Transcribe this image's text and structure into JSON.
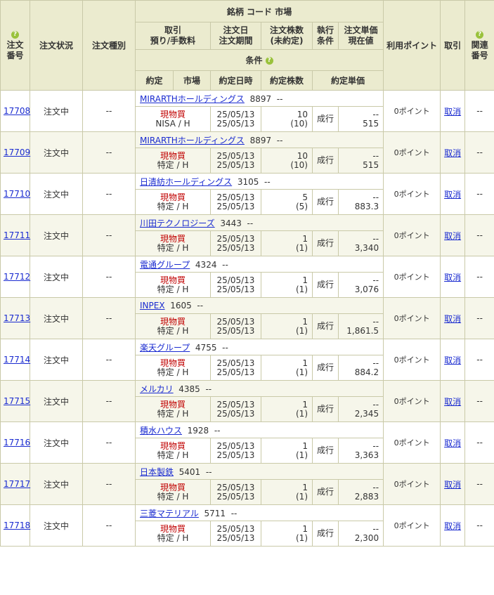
{
  "headers": {
    "order_no": [
      "注文",
      "番号"
    ],
    "status": "注文状況",
    "type": "注文種別",
    "stock": "銘柄 コード 市場",
    "trade": [
      "取引",
      "預り/手数料"
    ],
    "date": [
      "注文日",
      "注文期間"
    ],
    "qty": [
      "注文株数",
      "(未約定)"
    ],
    "exec": [
      "執行",
      "条件"
    ],
    "price": [
      "注文単価",
      "現在値"
    ],
    "cond": "条件",
    "yakujo": "約定",
    "market": "市場",
    "yakujo_date": "約定日時",
    "yakujo_qty": "約定株数",
    "yakujo_price": "約定単価",
    "points": "利用ポイント",
    "action": "取引",
    "related": [
      "関連",
      "番号"
    ]
  },
  "orders": [
    {
      "no": "17708",
      "status": "注文中",
      "type": "--",
      "name": "MIRARTHホールディングス",
      "code": "8897",
      "market": "--",
      "trade": "現物買",
      "account": "NISA / H",
      "d1": "25/05/13",
      "d2": "25/05/13",
      "qty": "10",
      "pending": "(10)",
      "exec": "成行",
      "price": "--",
      "current": "515",
      "points": "0ポイント",
      "action": "取消",
      "related": "--"
    },
    {
      "no": "17709",
      "status": "注文中",
      "type": "--",
      "name": "MIRARTHホールディングス",
      "code": "8897",
      "market": "--",
      "trade": "現物買",
      "account": "特定 / H",
      "d1": "25/05/13",
      "d2": "25/05/13",
      "qty": "10",
      "pending": "(10)",
      "exec": "成行",
      "price": "--",
      "current": "515",
      "points": "0ポイント",
      "action": "取消",
      "related": "--"
    },
    {
      "no": "17710",
      "status": "注文中",
      "type": "--",
      "name": "日清紡ホールディングス",
      "code": "3105",
      "market": "--",
      "trade": "現物買",
      "account": "特定 / H",
      "d1": "25/05/13",
      "d2": "25/05/13",
      "qty": "5",
      "pending": "(5)",
      "exec": "成行",
      "price": "--",
      "current": "883.3",
      "points": "0ポイント",
      "action": "取消",
      "related": "--"
    },
    {
      "no": "17711",
      "status": "注文中",
      "type": "--",
      "name": "川田テクノロジーズ",
      "code": "3443",
      "market": "--",
      "trade": "現物買",
      "account": "特定 / H",
      "d1": "25/05/13",
      "d2": "25/05/13",
      "qty": "1",
      "pending": "(1)",
      "exec": "成行",
      "price": "--",
      "current": "3,340",
      "points": "0ポイント",
      "action": "取消",
      "related": "--"
    },
    {
      "no": "17712",
      "status": "注文中",
      "type": "--",
      "name": "電通グループ",
      "code": "4324",
      "market": "--",
      "trade": "現物買",
      "account": "特定 / H",
      "d1": "25/05/13",
      "d2": "25/05/13",
      "qty": "1",
      "pending": "(1)",
      "exec": "成行",
      "price": "--",
      "current": "3,076",
      "points": "0ポイント",
      "action": "取消",
      "related": "--"
    },
    {
      "no": "17713",
      "status": "注文中",
      "type": "--",
      "name": "INPEX",
      "code": "1605",
      "market": "--",
      "trade": "現物買",
      "account": "特定 / H",
      "d1": "25/05/13",
      "d2": "25/05/13",
      "qty": "1",
      "pending": "(1)",
      "exec": "成行",
      "price": "--",
      "current": "1,861.5",
      "points": "0ポイント",
      "action": "取消",
      "related": "--"
    },
    {
      "no": "17714",
      "status": "注文中",
      "type": "--",
      "name": "楽天グループ",
      "code": "4755",
      "market": "--",
      "trade": "現物買",
      "account": "特定 / H",
      "d1": "25/05/13",
      "d2": "25/05/13",
      "qty": "1",
      "pending": "(1)",
      "exec": "成行",
      "price": "--",
      "current": "884.2",
      "points": "0ポイント",
      "action": "取消",
      "related": "--"
    },
    {
      "no": "17715",
      "status": "注文中",
      "type": "--",
      "name": "メルカリ",
      "code": "4385",
      "market": "--",
      "trade": "現物買",
      "account": "特定 / H",
      "d1": "25/05/13",
      "d2": "25/05/13",
      "qty": "1",
      "pending": "(1)",
      "exec": "成行",
      "price": "--",
      "current": "2,345",
      "points": "0ポイント",
      "action": "取消",
      "related": "--"
    },
    {
      "no": "17716",
      "status": "注文中",
      "type": "--",
      "name": "積水ハウス",
      "code": "1928",
      "market": "--",
      "trade": "現物買",
      "account": "特定 / H",
      "d1": "25/05/13",
      "d2": "25/05/13",
      "qty": "1",
      "pending": "(1)",
      "exec": "成行",
      "price": "--",
      "current": "3,363",
      "points": "0ポイント",
      "action": "取消",
      "related": "--"
    },
    {
      "no": "17717",
      "status": "注文中",
      "type": "--",
      "name": "日本製鉄",
      "code": "5401",
      "market": "--",
      "trade": "現物買",
      "account": "特定 / H",
      "d1": "25/05/13",
      "d2": "25/05/13",
      "qty": "1",
      "pending": "(1)",
      "exec": "成行",
      "price": "--",
      "current": "2,883",
      "points": "0ポイント",
      "action": "取消",
      "related": "--"
    },
    {
      "no": "17718",
      "status": "注文中",
      "type": "--",
      "name": "三菱マテリアル",
      "code": "5711",
      "market": "--",
      "trade": "現物買",
      "account": "特定 / H",
      "d1": "25/05/13",
      "d2": "25/05/13",
      "qty": "1",
      "pending": "(1)",
      "exec": "成行",
      "price": "--",
      "current": "2,300",
      "points": "0ポイント",
      "action": "取消",
      "related": "--"
    }
  ]
}
